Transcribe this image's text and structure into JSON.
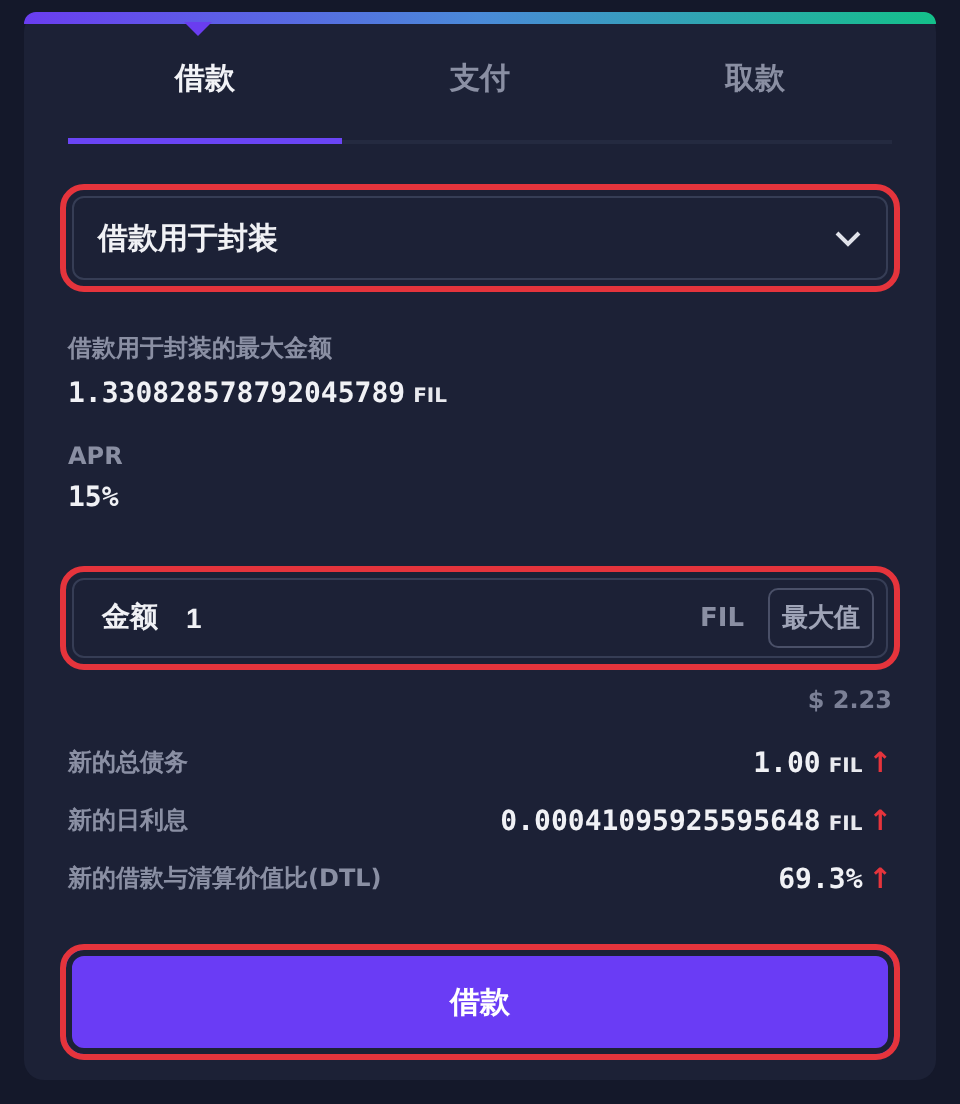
{
  "tabs": [
    {
      "label": "借款",
      "selected": true
    },
    {
      "label": "支付",
      "selected": false
    },
    {
      "label": "取款",
      "selected": false
    }
  ],
  "purpose_select": {
    "value": "借款用于封装",
    "highlighted": true
  },
  "max_amount": {
    "label": "借款用于封装的最大金额",
    "value": "1.330828578792045789",
    "unit": "FIL"
  },
  "apr": {
    "label": "APR",
    "value": "15%"
  },
  "amount_field": {
    "label": "金额",
    "value": "1",
    "unit": "FIL",
    "max_button": "最大值",
    "highlighted": true
  },
  "usd_value": "$ 2.23",
  "summary": [
    {
      "label": "新的总债务",
      "value": "1.00",
      "unit": "FIL",
      "trend": "↑"
    },
    {
      "label": "新的日利息",
      "value": "0.00041095925595648",
      "unit": "FIL",
      "trend": "↑"
    },
    {
      "label": "新的借款与清算价值比(DTL)",
      "value": "69.3%",
      "trend": "↑"
    }
  ],
  "submit_button": {
    "label": "借款",
    "highlighted": true
  }
}
